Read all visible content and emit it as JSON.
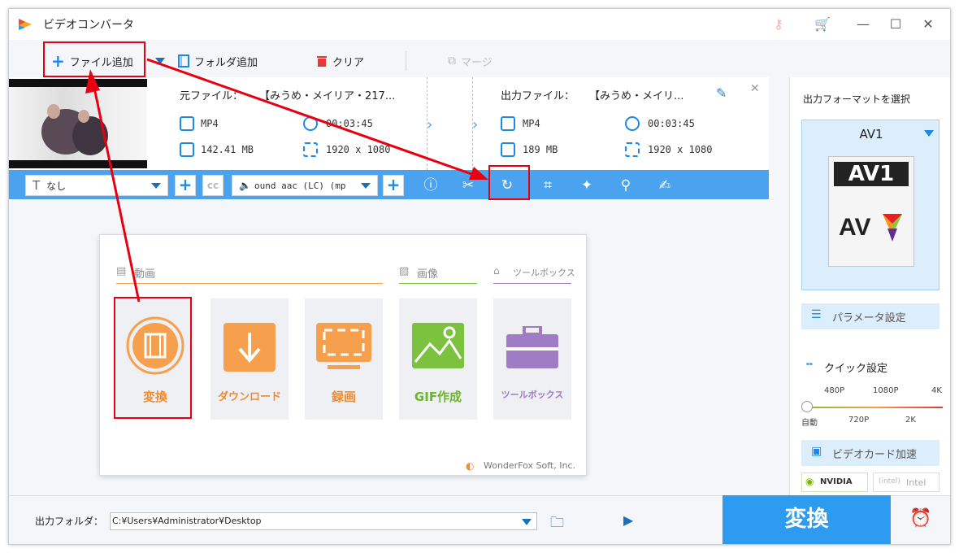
{
  "window": {
    "title": "ビデオコンバータ"
  },
  "toolbar": {
    "add_file": "ファイル追加",
    "add_folder": "フォルダ追加",
    "clear": "クリア",
    "merge": "マージ"
  },
  "file": {
    "source_label": "元ファイル：",
    "source_name": "【みうめ・メイリア・217...",
    "source_format": "MP4",
    "source_duration": "00:03:45",
    "source_size": "142.41 MB",
    "source_resolution": "1920 x 1080",
    "output_label": "出力ファイル：",
    "output_name": "【みうめ・メイリ...",
    "output_format": "MP4",
    "output_duration": "00:03:45",
    "output_size": "189 MB",
    "output_resolution": "1920 x 1080"
  },
  "editbar": {
    "subtitle_value": "なし",
    "audio_value": "ound aac (LC) (mp"
  },
  "home": {
    "video_section": "動画",
    "image_section": "画像",
    "toolbox_section": "ツールボックス",
    "tiles": [
      {
        "label": "変換"
      },
      {
        "label": "ダウンロード"
      },
      {
        "label": "録画"
      },
      {
        "label": "GIF作成"
      },
      {
        "label": "ツールボックス"
      }
    ],
    "brand": "WonderFox Soft, Inc."
  },
  "right": {
    "choose_format": "出力フォーマットを選択",
    "format_name": "AV1",
    "format_badge": "AV1",
    "params_button": "パラメータ設定",
    "quick_settings": "クイック設定",
    "q_labels_top": [
      "480P",
      "1080P",
      "4K"
    ],
    "q_labels_bottom": [
      "自動",
      "720P",
      "2K"
    ],
    "gpu_accel": "ビデオカード加速",
    "nvidia": "NVIDIA",
    "intel": "Intel"
  },
  "bottom": {
    "output_folder_label": "出力フォルダ：",
    "output_path": "C:¥Users¥Administrator¥Desktop",
    "convert": "変換"
  },
  "colors": {
    "accent": "#2d9cf0",
    "annotation_red": "#e60012",
    "video_orange": "#f6a04d",
    "gif_green": "#7dc23f",
    "toolbox_purple": "#a07cc5"
  }
}
